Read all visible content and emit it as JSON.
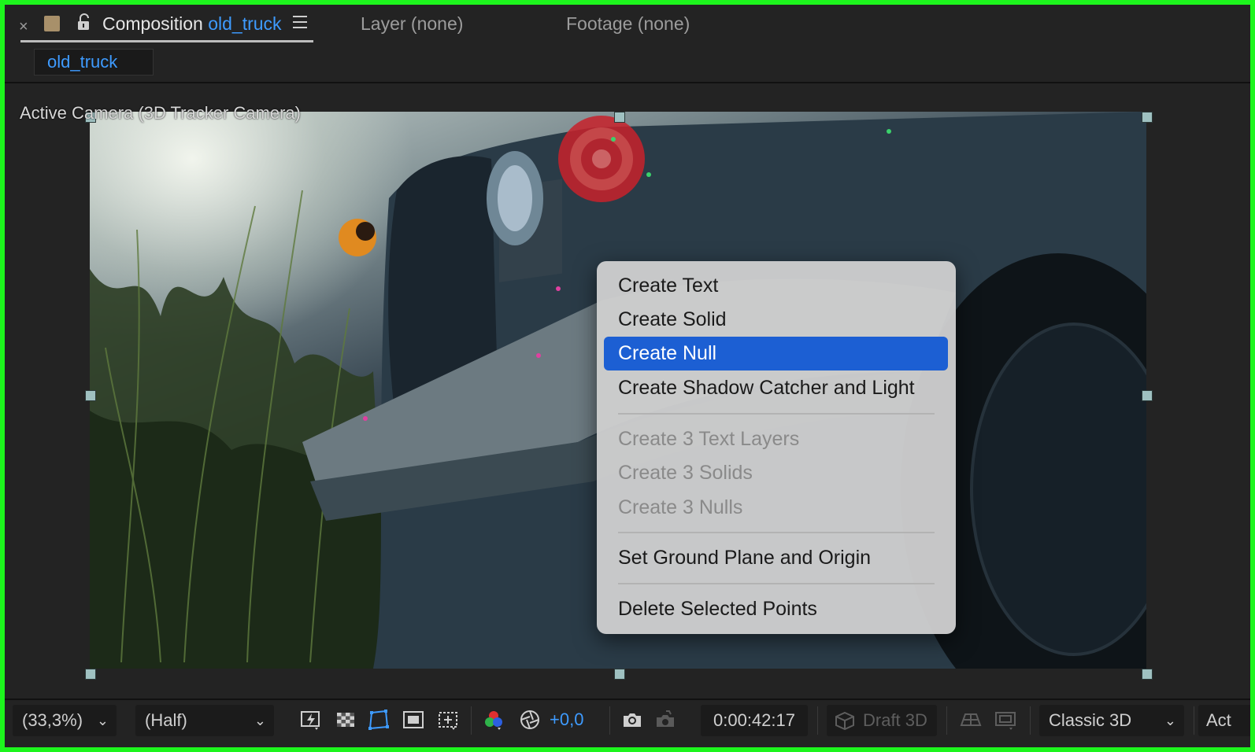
{
  "tabs": {
    "close_glyph": "×",
    "active": {
      "prefix": "Composition",
      "name": "old_truck"
    },
    "layer_tab": "Layer (none)",
    "footage_tab": "Footage (none)",
    "sub_tab": "old_truck"
  },
  "viewer": {
    "camera_label": "Active Camera (3D Tracker Camera)"
  },
  "context_menu": {
    "items": [
      {
        "label": "Create Text",
        "enabled": true
      },
      {
        "label": "Create Solid",
        "enabled": true
      },
      {
        "label": "Create Null",
        "enabled": true,
        "selected": true
      },
      {
        "label": "Create Shadow Catcher and Light",
        "enabled": true
      },
      {
        "label": "Create 3 Text Layers",
        "enabled": false
      },
      {
        "label": "Create 3 Solids",
        "enabled": false
      },
      {
        "label": "Create 3 Nulls",
        "enabled": false
      },
      {
        "label": "Set Ground Plane and Origin",
        "enabled": true
      },
      {
        "label": "Delete Selected Points",
        "enabled": true
      }
    ]
  },
  "toolbar": {
    "zoom": "(33,3%)",
    "resolution": "(Half)",
    "exposure": "+0,0",
    "timecode": "0:00:42:17",
    "draft_3d": "Draft 3D",
    "renderer": "Classic 3D",
    "active_camera_short": "Act"
  },
  "colors": {
    "accent_blue": "#3e9bff",
    "selection_blue": "#1c5fd3",
    "frame_green": "#1df51d"
  }
}
